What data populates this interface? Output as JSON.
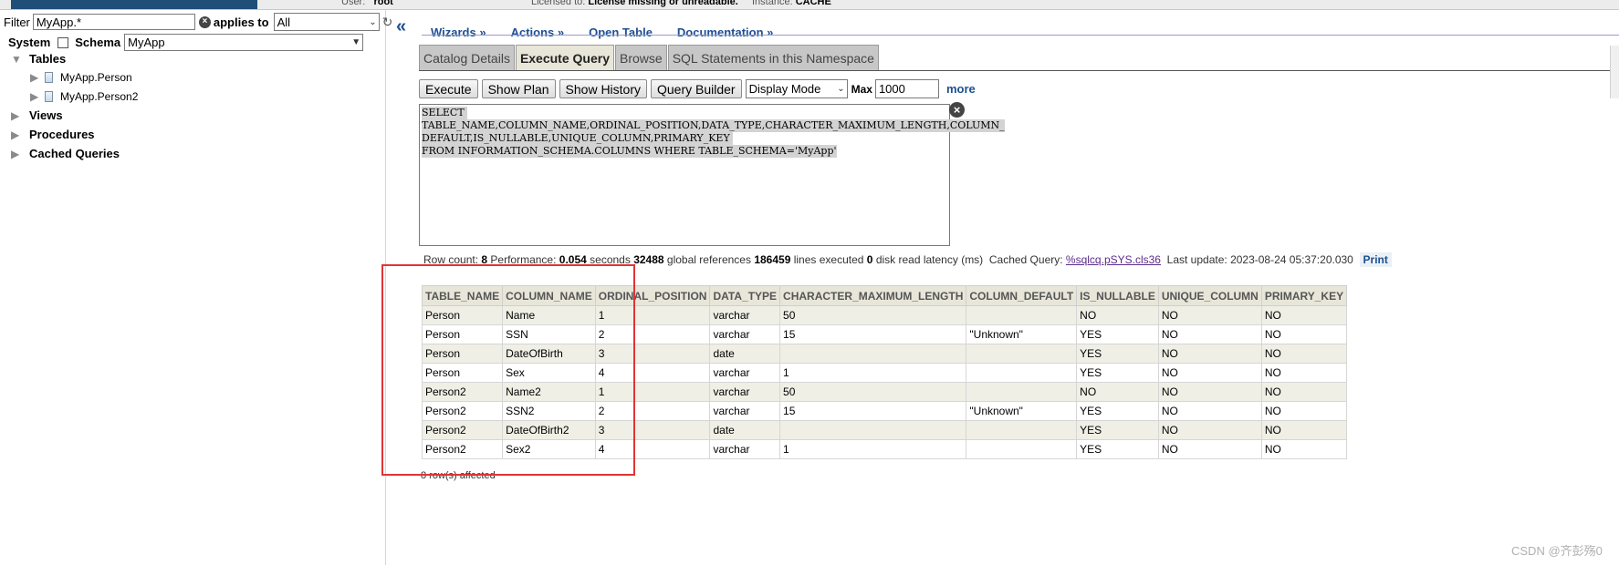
{
  "header": {
    "user_label": "User:",
    "user_value": "root",
    "license_label": "Licensed to:",
    "license_value": "License missing or unreadable.",
    "instance_label": "Instance:",
    "instance_value": "CACHE"
  },
  "sidebar": {
    "filter_label": "Filter",
    "filter_value": "MyApp.*",
    "applies_label": "applies to",
    "applies_value": "All",
    "system_label": "System",
    "schema_label": "Schema",
    "schema_value": "MyApp",
    "tree": {
      "tables": "Tables",
      "table_items": [
        "MyApp.Person",
        "MyApp.Person2"
      ],
      "views": "Views",
      "procedures": "Procedures",
      "cached_queries": "Cached Queries"
    }
  },
  "menu": [
    "Wizards »",
    "Actions »",
    "Open Table",
    "Documentation »"
  ],
  "tabs": [
    "Catalog Details",
    "Execute Query",
    "Browse",
    "SQL Statements in this Namespace"
  ],
  "toolbar": {
    "execute": "Execute",
    "show_plan": "Show Plan",
    "show_history": "Show History",
    "query_builder": "Query Builder",
    "display_mode": "Display Mode",
    "max_label": "Max",
    "max_value": "1000",
    "more": "more"
  },
  "query": {
    "lines": [
      "SELECT ",
      "TABLE_NAME,COLUMN_NAME,ORDINAL_POSITION,DATA_TYPE,CHARACTER_MAXIMUM_LENGTH,COLUMN_",
      "DEFAULT,IS_NULLABLE,UNIQUE_COLUMN,PRIMARY_KEY ",
      "FROM INFORMATION_SCHEMA.COLUMNS WHERE TABLE_SCHEMA='MyApp'"
    ]
  },
  "stats": {
    "row_count_label": "Row count:",
    "row_count": "8",
    "performance_label": "Performance:",
    "seconds": "0.054",
    "seconds_label": "seconds",
    "global_refs": "32488",
    "global_refs_label": "global references",
    "lines_exec": "186459",
    "lines_exec_label": "lines executed",
    "disk_latency": "0",
    "disk_latency_label": "disk read latency (ms)",
    "cached_label": "Cached Query:",
    "cached_value": "%sqlcq.pSYS.cls36",
    "update_label": "Last update:",
    "update_value": "2023-08-24 05:37:20.030",
    "print": "Print"
  },
  "results": {
    "columns": [
      "TABLE_NAME",
      "COLUMN_NAME",
      "ORDINAL_POSITION",
      "DATA_TYPE",
      "CHARACTER_MAXIMUM_LENGTH",
      "COLUMN_DEFAULT",
      "IS_NULLABLE",
      "UNIQUE_COLUMN",
      "PRIMARY_KEY"
    ],
    "rows": [
      [
        "Person",
        "Name",
        "1",
        "varchar",
        "50",
        "",
        "NO",
        "NO",
        "NO"
      ],
      [
        "Person",
        "SSN",
        "2",
        "varchar",
        "15",
        "\"Unknown\"",
        "YES",
        "NO",
        "NO"
      ],
      [
        "Person",
        "DateOfBirth",
        "3",
        "date",
        "",
        "",
        "YES",
        "NO",
        "NO"
      ],
      [
        "Person",
        "Sex",
        "4",
        "varchar",
        "1",
        "",
        "YES",
        "NO",
        "NO"
      ],
      [
        "Person2",
        "Name2",
        "1",
        "varchar",
        "50",
        "",
        "NO",
        "NO",
        "NO"
      ],
      [
        "Person2",
        "SSN2",
        "2",
        "varchar",
        "15",
        "\"Unknown\"",
        "YES",
        "NO",
        "NO"
      ],
      [
        "Person2",
        "DateOfBirth2",
        "3",
        "date",
        "",
        "",
        "YES",
        "NO",
        "NO"
      ],
      [
        "Person2",
        "Sex2",
        "4",
        "varchar",
        "1",
        "",
        "YES",
        "NO",
        "NO"
      ]
    ],
    "affected": "8 row(s) affected"
  },
  "watermark": "CSDN @齐彭殇0",
  "colors": {
    "link": "#1d4f91",
    "highlight_box": "#e03434",
    "header_bg": "#e8e6d9"
  }
}
